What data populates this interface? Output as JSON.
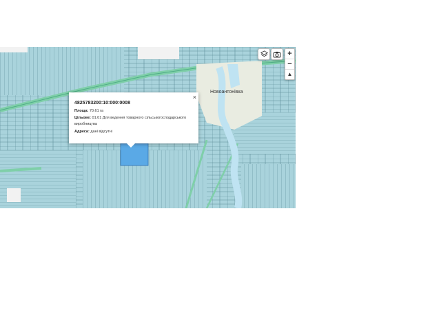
{
  "map": {
    "place_label": "Новоантонівка"
  },
  "controls": {
    "layers_icon": "layers-icon",
    "camera_icon": "camera-icon",
    "zoom_in": "+",
    "zoom_out": "−",
    "north": "▲"
  },
  "popup": {
    "close": "×",
    "cadastral_number": "4825783200:10:000:0008",
    "area_label": "Площа:",
    "area_value": "70.61 га",
    "purpose_label": "Цільове:",
    "purpose_value": "01.01 Для ведення товарного сільськогосподарського виробництва",
    "address_label": "Адреса:",
    "address_value": "дані відсутні"
  },
  "colors": {
    "parcel": "#a9d3dc",
    "parcel_line": "#5d8f99",
    "road": "#7fcfa9",
    "selected": "#5aa9e6",
    "settlement": "#e9ece1",
    "water": "#bfe3f2"
  }
}
